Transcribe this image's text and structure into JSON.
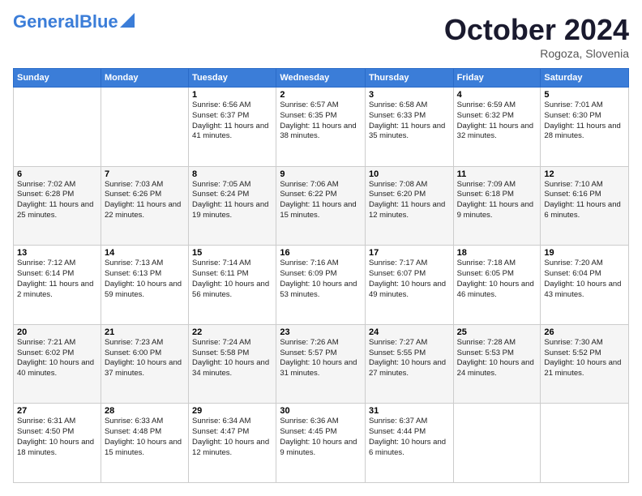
{
  "header": {
    "logo_general": "General",
    "logo_blue": "Blue",
    "title": "October 2024",
    "subtitle": "Rogoza, Slovenia"
  },
  "weekdays": [
    "Sunday",
    "Monday",
    "Tuesday",
    "Wednesday",
    "Thursday",
    "Friday",
    "Saturday"
  ],
  "weeks": [
    [
      {
        "day": "",
        "sunrise": "",
        "sunset": "",
        "daylight": ""
      },
      {
        "day": "",
        "sunrise": "",
        "sunset": "",
        "daylight": ""
      },
      {
        "day": "1",
        "sunrise": "Sunrise: 6:56 AM",
        "sunset": "Sunset: 6:37 PM",
        "daylight": "Daylight: 11 hours and 41 minutes."
      },
      {
        "day": "2",
        "sunrise": "Sunrise: 6:57 AM",
        "sunset": "Sunset: 6:35 PM",
        "daylight": "Daylight: 11 hours and 38 minutes."
      },
      {
        "day": "3",
        "sunrise": "Sunrise: 6:58 AM",
        "sunset": "Sunset: 6:33 PM",
        "daylight": "Daylight: 11 hours and 35 minutes."
      },
      {
        "day": "4",
        "sunrise": "Sunrise: 6:59 AM",
        "sunset": "Sunset: 6:32 PM",
        "daylight": "Daylight: 11 hours and 32 minutes."
      },
      {
        "day": "5",
        "sunrise": "Sunrise: 7:01 AM",
        "sunset": "Sunset: 6:30 PM",
        "daylight": "Daylight: 11 hours and 28 minutes."
      }
    ],
    [
      {
        "day": "6",
        "sunrise": "Sunrise: 7:02 AM",
        "sunset": "Sunset: 6:28 PM",
        "daylight": "Daylight: 11 hours and 25 minutes."
      },
      {
        "day": "7",
        "sunrise": "Sunrise: 7:03 AM",
        "sunset": "Sunset: 6:26 PM",
        "daylight": "Daylight: 11 hours and 22 minutes."
      },
      {
        "day": "8",
        "sunrise": "Sunrise: 7:05 AM",
        "sunset": "Sunset: 6:24 PM",
        "daylight": "Daylight: 11 hours and 19 minutes."
      },
      {
        "day": "9",
        "sunrise": "Sunrise: 7:06 AM",
        "sunset": "Sunset: 6:22 PM",
        "daylight": "Daylight: 11 hours and 15 minutes."
      },
      {
        "day": "10",
        "sunrise": "Sunrise: 7:08 AM",
        "sunset": "Sunset: 6:20 PM",
        "daylight": "Daylight: 11 hours and 12 minutes."
      },
      {
        "day": "11",
        "sunrise": "Sunrise: 7:09 AM",
        "sunset": "Sunset: 6:18 PM",
        "daylight": "Daylight: 11 hours and 9 minutes."
      },
      {
        "day": "12",
        "sunrise": "Sunrise: 7:10 AM",
        "sunset": "Sunset: 6:16 PM",
        "daylight": "Daylight: 11 hours and 6 minutes."
      }
    ],
    [
      {
        "day": "13",
        "sunrise": "Sunrise: 7:12 AM",
        "sunset": "Sunset: 6:14 PM",
        "daylight": "Daylight: 11 hours and 2 minutes."
      },
      {
        "day": "14",
        "sunrise": "Sunrise: 7:13 AM",
        "sunset": "Sunset: 6:13 PM",
        "daylight": "Daylight: 10 hours and 59 minutes."
      },
      {
        "day": "15",
        "sunrise": "Sunrise: 7:14 AM",
        "sunset": "Sunset: 6:11 PM",
        "daylight": "Daylight: 10 hours and 56 minutes."
      },
      {
        "day": "16",
        "sunrise": "Sunrise: 7:16 AM",
        "sunset": "Sunset: 6:09 PM",
        "daylight": "Daylight: 10 hours and 53 minutes."
      },
      {
        "day": "17",
        "sunrise": "Sunrise: 7:17 AM",
        "sunset": "Sunset: 6:07 PM",
        "daylight": "Daylight: 10 hours and 49 minutes."
      },
      {
        "day": "18",
        "sunrise": "Sunrise: 7:18 AM",
        "sunset": "Sunset: 6:05 PM",
        "daylight": "Daylight: 10 hours and 46 minutes."
      },
      {
        "day": "19",
        "sunrise": "Sunrise: 7:20 AM",
        "sunset": "Sunset: 6:04 PM",
        "daylight": "Daylight: 10 hours and 43 minutes."
      }
    ],
    [
      {
        "day": "20",
        "sunrise": "Sunrise: 7:21 AM",
        "sunset": "Sunset: 6:02 PM",
        "daylight": "Daylight: 10 hours and 40 minutes."
      },
      {
        "day": "21",
        "sunrise": "Sunrise: 7:23 AM",
        "sunset": "Sunset: 6:00 PM",
        "daylight": "Daylight: 10 hours and 37 minutes."
      },
      {
        "day": "22",
        "sunrise": "Sunrise: 7:24 AM",
        "sunset": "Sunset: 5:58 PM",
        "daylight": "Daylight: 10 hours and 34 minutes."
      },
      {
        "day": "23",
        "sunrise": "Sunrise: 7:26 AM",
        "sunset": "Sunset: 5:57 PM",
        "daylight": "Daylight: 10 hours and 31 minutes."
      },
      {
        "day": "24",
        "sunrise": "Sunrise: 7:27 AM",
        "sunset": "Sunset: 5:55 PM",
        "daylight": "Daylight: 10 hours and 27 minutes."
      },
      {
        "day": "25",
        "sunrise": "Sunrise: 7:28 AM",
        "sunset": "Sunset: 5:53 PM",
        "daylight": "Daylight: 10 hours and 24 minutes."
      },
      {
        "day": "26",
        "sunrise": "Sunrise: 7:30 AM",
        "sunset": "Sunset: 5:52 PM",
        "daylight": "Daylight: 10 hours and 21 minutes."
      }
    ],
    [
      {
        "day": "27",
        "sunrise": "Sunrise: 6:31 AM",
        "sunset": "Sunset: 4:50 PM",
        "daylight": "Daylight: 10 hours and 18 minutes."
      },
      {
        "day": "28",
        "sunrise": "Sunrise: 6:33 AM",
        "sunset": "Sunset: 4:48 PM",
        "daylight": "Daylight: 10 hours and 15 minutes."
      },
      {
        "day": "29",
        "sunrise": "Sunrise: 6:34 AM",
        "sunset": "Sunset: 4:47 PM",
        "daylight": "Daylight: 10 hours and 12 minutes."
      },
      {
        "day": "30",
        "sunrise": "Sunrise: 6:36 AM",
        "sunset": "Sunset: 4:45 PM",
        "daylight": "Daylight: 10 hours and 9 minutes."
      },
      {
        "day": "31",
        "sunrise": "Sunrise: 6:37 AM",
        "sunset": "Sunset: 4:44 PM",
        "daylight": "Daylight: 10 hours and 6 minutes."
      },
      {
        "day": "",
        "sunrise": "",
        "sunset": "",
        "daylight": ""
      },
      {
        "day": "",
        "sunrise": "",
        "sunset": "",
        "daylight": ""
      }
    ]
  ]
}
